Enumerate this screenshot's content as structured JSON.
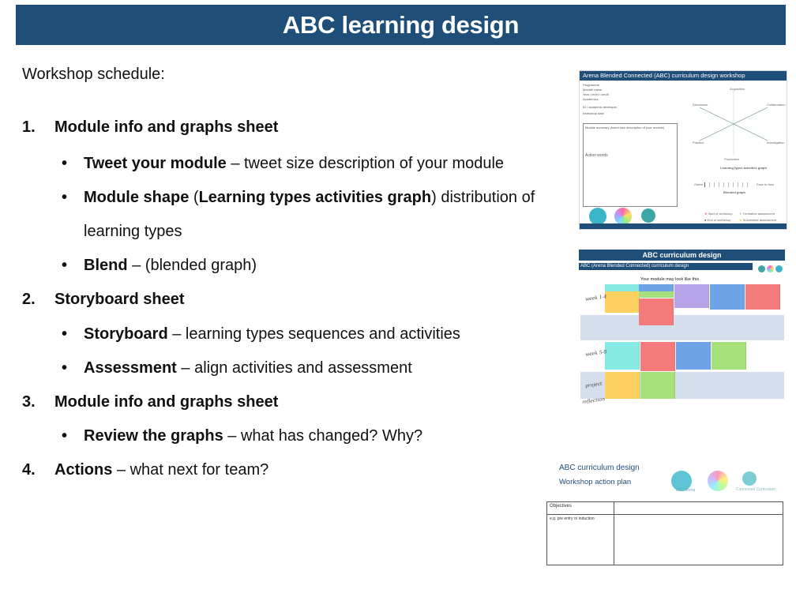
{
  "header": {
    "title": "ABC learning design"
  },
  "schedule": {
    "intro": "Workshop schedule:",
    "steps": [
      {
        "number": "1.",
        "title": "Module info and graphs sheet",
        "bullets": [
          {
            "bold": "Tweet your module",
            "text": " – tweet size description of your module"
          },
          {
            "bold": "Module shape",
            "text_a": " (",
            "bold_b": "Learning types activities graph",
            "text": ") distribution of",
            "continuation": "learning types"
          },
          {
            "bold": "Blend",
            "text": " – (blended graph)"
          }
        ]
      },
      {
        "number": "2.",
        "title": "Storyboard sheet",
        "bullets": [
          {
            "bold": "Storyboard",
            "text": " – learning types sequences and activities"
          },
          {
            "bold": "Assessment",
            "text": " – align activities and assessment"
          }
        ]
      },
      {
        "number": "3.",
        "title": "Module info and graphs sheet",
        "bullets": [
          {
            "bold": "Review  the graphs",
            "text": " – what has changed? Why?"
          }
        ]
      },
      {
        "number": "4.",
        "title": "Actions",
        "title_suffix": " – what next for team?"
      }
    ]
  },
  "thumbnails": {
    "module_sheet": {
      "header": "Arena Blended Connected (ABC) curriculum design workshop",
      "fields": [
        "Programme",
        "Module name",
        "Year / level / credit",
        "Academics",
        "",
        "ID / academic developer",
        "Workshop date"
      ],
      "box_title": "Module summary (tweet size description of your module)",
      "box_note": "Action words",
      "radar_labels": [
        "Acquisition",
        "Collaboration",
        "Discussion",
        "Investigation",
        "Practice",
        "Production"
      ],
      "graph_title": "Learning types activities graph",
      "blend_title": "Blended graph",
      "blend_left": "Online",
      "blend_right": "Face to face",
      "legend": [
        "Start of workshop",
        "End of workshop",
        "Formative assessment",
        "Summative assessment"
      ],
      "logos": [
        "UCL Arena",
        "Blended learning",
        "Connected Curriculum"
      ]
    },
    "storyboard_sheet": {
      "title": "ABC curriculum design",
      "subtitle": "ABC (Arena Blended Connected) curriculum design",
      "caption": "Your module  may look like this",
      "handwritten": [
        "week 1-4",
        "week 5-8",
        "project",
        "reflection"
      ],
      "colors": {
        "acquisition": "#f47b7b",
        "collaboration": "#fdd160",
        "discussion": "#6fa3e8",
        "investigation": "#f47b7b",
        "practice": "#b6a3e8",
        "production": "#a6e07a",
        "cyan": "#87e9e4",
        "band": "#d4deec"
      }
    },
    "action_plan": {
      "title": "ABC curriculum design",
      "subtitle": "Workshop action plan",
      "logos": [
        "UCL Arena",
        "Blended learning",
        "Connected Curriculum"
      ],
      "table": [
        [
          "Objectives",
          ""
        ],
        [
          "e.g. pre entry or induction",
          ""
        ]
      ]
    }
  }
}
